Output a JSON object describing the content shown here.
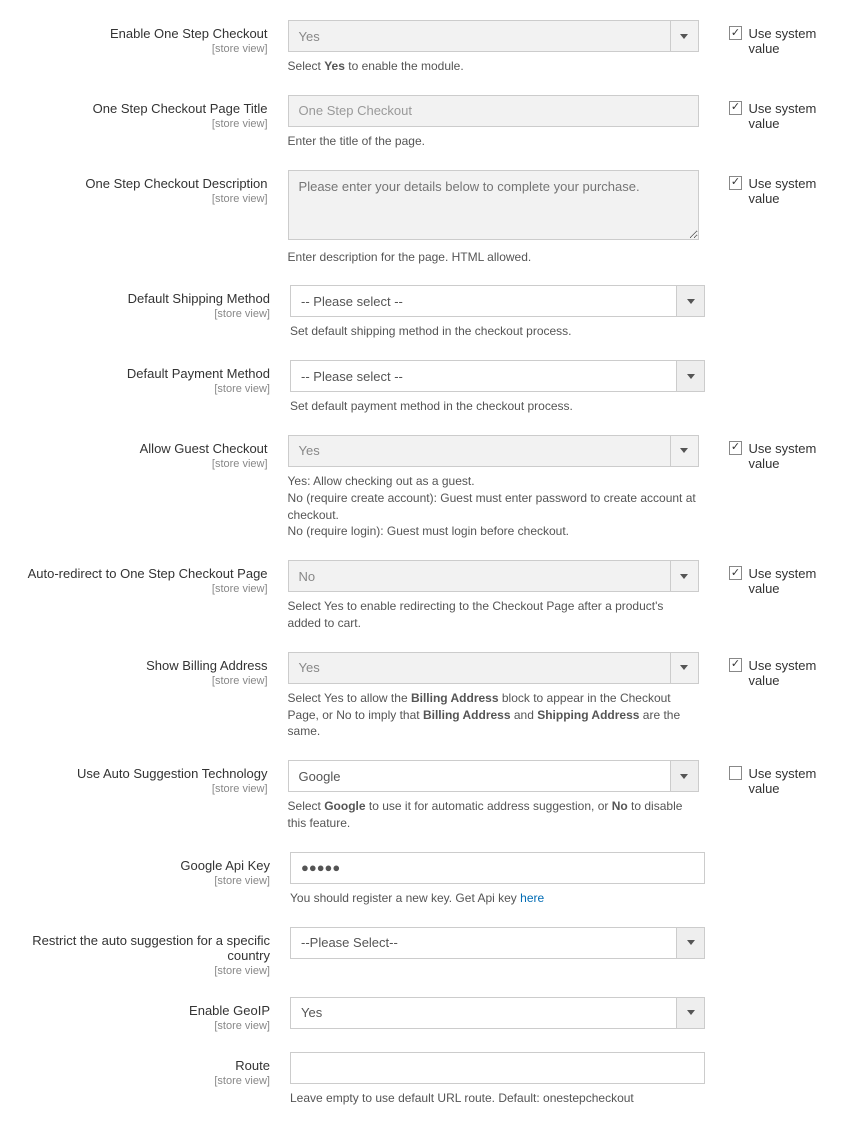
{
  "common": {
    "scope": "[store view]",
    "useSystem": "Use system value"
  },
  "fields": {
    "enable": {
      "label": "Enable One Step Checkout",
      "value": "Yes",
      "note_pre": "Select ",
      "note_bold": "Yes",
      "note_post": " to enable the module."
    },
    "pageTitle": {
      "label": "One Step Checkout Page Title",
      "placeholder": "One Step Checkout",
      "note": "Enter the title of the page."
    },
    "description": {
      "label": "One Step Checkout Description",
      "placeholder": "Please enter your details below to complete your purchase.",
      "note": "Enter description for the page. HTML allowed."
    },
    "defaultShipping": {
      "label": "Default Shipping Method",
      "value": "-- Please select --",
      "note": "Set default shipping method in the checkout process."
    },
    "defaultPayment": {
      "label": "Default Payment Method",
      "value": "-- Please select --",
      "note": "Set default payment method in the checkout process."
    },
    "allowGuest": {
      "label": "Allow Guest Checkout",
      "value": "Yes",
      "note_l1": "Yes: Allow checking out as a guest.",
      "note_l2": "No (require create account): Guest must enter password to create account at checkout.",
      "note_l3": "No (require login): Guest must login before checkout."
    },
    "autoRedirect": {
      "label": "Auto-redirect to One Step Checkout Page",
      "value": "No",
      "note": "Select Yes to enable redirecting to the Checkout Page after a product's added to cart."
    },
    "showBilling": {
      "label": "Show Billing Address",
      "value": "Yes",
      "note_1": "Select Yes to allow the ",
      "note_b1": "Billing Address",
      "note_2": " block to appear in the Checkout Page, or No to imply that ",
      "note_b2": "Billing Address",
      "note_3": " and ",
      "note_b3": "Shipping Address",
      "note_4": " are the same."
    },
    "autoSuggest": {
      "label": "Use Auto Suggestion Technology",
      "value": "Google",
      "note_1": "Select ",
      "note_b1": "Google",
      "note_2": " to use it for automatic address suggestion, or ",
      "note_b2": "No",
      "note_3": " to disable this feature."
    },
    "googleKey": {
      "label": "Google Api Key",
      "value": "●●●●●",
      "note_pre": "You should register a new key. Get Api key ",
      "note_link": "here"
    },
    "restrictCountry": {
      "label": "Restrict the auto suggestion for a specific country",
      "value": "--Please Select--"
    },
    "enableGeoip": {
      "label": "Enable GeoIP",
      "value": "Yes"
    },
    "route": {
      "label": "Route",
      "value": "",
      "note": "Leave empty to use default URL route. Default: onestepcheckout"
    }
  }
}
